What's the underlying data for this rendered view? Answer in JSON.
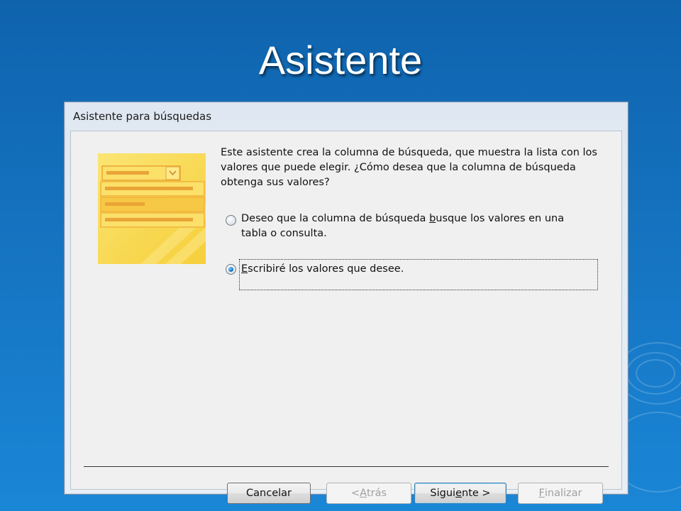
{
  "slide": {
    "title": "Asistente"
  },
  "window": {
    "title": "Asistente para búsquedas"
  },
  "description": "Este asistente crea la columna de búsqueda, que muestra la lista con los valores que puede elegir. ¿Cómo desea que la columna de búsqueda obtenga sus valores?",
  "options": [
    {
      "label_pre": "Deseo que la columna de búsqueda ",
      "label_key": "b",
      "label_post": "usque los valores en una tabla o consulta.",
      "selected": false
    },
    {
      "label_pre": "",
      "label_key": "E",
      "label_post": "scribiré los valores que desee.",
      "selected": true
    }
  ],
  "buttons": {
    "cancel": {
      "label": "Cancelar"
    },
    "back": {
      "label_pre": "< ",
      "label_key": "A",
      "label_post": "trás",
      "enabled": false
    },
    "next": {
      "label_pre": "Sigui",
      "label_key": "e",
      "label_post": "nte >",
      "enabled": true
    },
    "finish": {
      "label_key": "F",
      "label_post": "inalizar",
      "enabled": false
    }
  },
  "illustration": {
    "icon": "lookup-wizard-illustration",
    "colors": {
      "primary": "#f7d64a",
      "accent": "#f0b43a"
    }
  }
}
